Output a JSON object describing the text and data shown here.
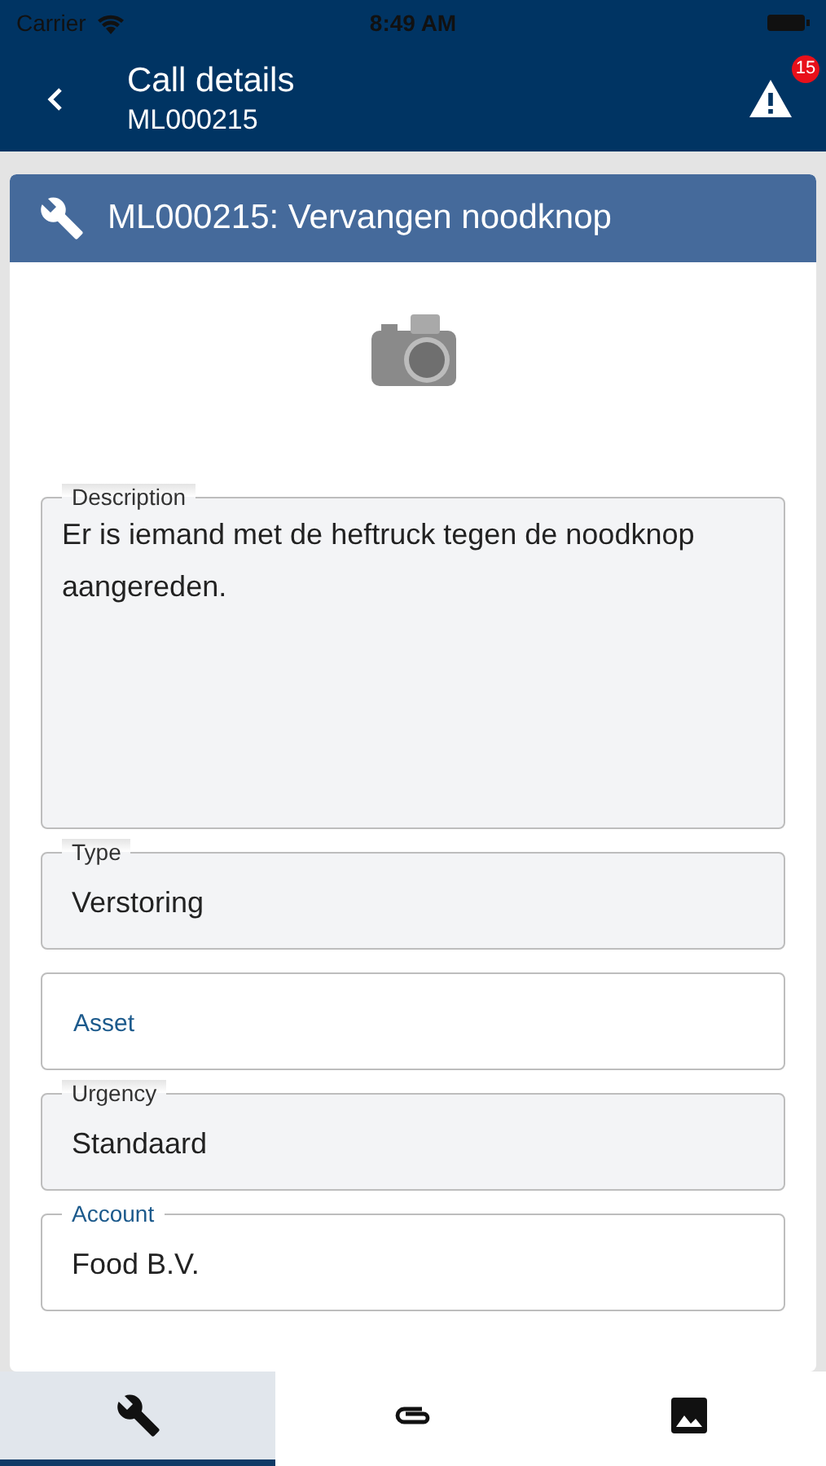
{
  "status_bar": {
    "carrier": "Carrier",
    "time": "8:49 AM"
  },
  "nav": {
    "title": "Call details",
    "subtitle": "ML000215",
    "alert_badge": "15"
  },
  "card": {
    "title": "ML000215: Vervangen noodknop"
  },
  "fields": [
    {
      "label": "Description",
      "value": "Er is iemand met de heftruck tegen de noodknop aangereden.",
      "readonly": true,
      "kind": "multiline"
    },
    {
      "label": "Type",
      "value": "Verstoring",
      "readonly": true,
      "kind": "single"
    },
    {
      "label": "Asset",
      "readonly": false,
      "kind": "single"
    },
    {
      "label": "Urgency",
      "value": "Standaard",
      "readonly": true,
      "kind": "single"
    },
    {
      "label": "Account",
      "value": "Food B.V.",
      "readonly": false,
      "kind": "single"
    }
  ],
  "tabs": [
    {
      "selected": true
    },
    {
      "selected": false
    },
    {
      "selected": false
    }
  ]
}
